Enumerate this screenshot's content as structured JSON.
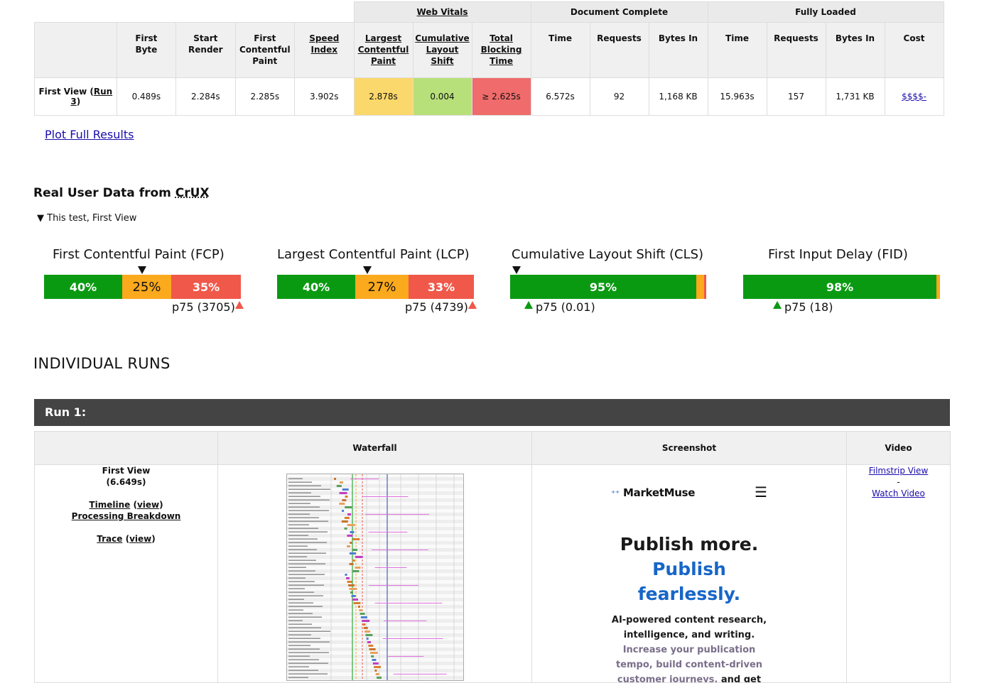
{
  "summary": {
    "groups": {
      "web_vitals": "Web Vitals",
      "document_complete": "Document Complete",
      "fully_loaded": "Fully Loaded"
    },
    "headers": {
      "first_byte": "First\nByte",
      "start_render": "Start\nRender",
      "first_contentful_paint": "First\nContentful\nPaint",
      "speed_index": "Speed\nIndex",
      "largest_contentful_paint": "Largest\nContentful\nPaint",
      "cumulative_layout_shift": "Cumulative\nLayout\nShift",
      "total_blocking_time": "Total\nBlocking\nTime",
      "dc_time": "Time",
      "dc_requests": "Requests",
      "dc_bytes": "Bytes In",
      "fl_time": "Time",
      "fl_requests": "Requests",
      "fl_bytes": "Bytes In",
      "cost": "Cost"
    },
    "row": {
      "label_prefix": "First View (",
      "label_link": "Run 3",
      "label_suffix": ")",
      "first_byte": "0.489s",
      "start_render": "2.284s",
      "fcp": "2.285s",
      "speed_index": "3.902s",
      "lcp": "2.878s",
      "cls": "0.004",
      "tbt": "≥ 2.625s",
      "dc_time": "6.572s",
      "dc_requests": "92",
      "dc_bytes": "1,168 KB",
      "fl_time": "15.963s",
      "fl_requests": "157",
      "fl_bytes": "1,731 KB",
      "cost": "$$$$-"
    },
    "colors": {
      "lcp": "#fbd86b",
      "cls": "#b8e07a",
      "tbt": "#f06b6b"
    }
  },
  "plot_link": "Plot Full Results",
  "crux": {
    "title_prefix": "Real User Data from ",
    "title_abbr": "CrUX",
    "toggle": "▼ This test, First View",
    "metrics": [
      {
        "title": "First Contentful Paint (FCP)",
        "good": 40,
        "needs": 25,
        "poor": 35,
        "good_label": "40%",
        "needs_label": "25%",
        "poor_label": "35%",
        "p75": "p75 (3705)",
        "marker_pct": 50
      },
      {
        "title": "Largest Contentful Paint (LCP)",
        "good": 40,
        "needs": 27,
        "poor": 33,
        "good_label": "40%",
        "needs_label": "27%",
        "poor_label": "33%",
        "p75": "p75 (4739)",
        "marker_pct": 46
      },
      {
        "title": "Cumulative Layout Shift (CLS)",
        "good": 95,
        "needs": 4,
        "poor": 1,
        "good_label": "95%",
        "p75": "p75 (0.01)",
        "marker_pct": 3
      },
      {
        "title": "First Input Delay (FID)",
        "good": 98,
        "needs": 2,
        "poor": 0,
        "good_label": "98%",
        "p75": "p75 (18)"
      }
    ]
  },
  "runs": {
    "title": "INDIVIDUAL RUNS",
    "run1": {
      "label": "Run 1:",
      "headers": {
        "waterfall": "Waterfall",
        "screenshot": "Screenshot",
        "video": "Video"
      },
      "first_view": "First View",
      "first_view_time": "(6.649s)",
      "timeline": "Timeline",
      "view": "view",
      "processing": "Processing Breakdown",
      "trace": "Trace",
      "filmstrip": "Filmstrip View",
      "sep": "-",
      "watch": "Watch Video",
      "screenshot": {
        "brand": "MarketMuse",
        "heading1": "Publish more.",
        "heading2": "Publish",
        "heading3": "fearlessly.",
        "para_dark1": "AI-powered content research, intelligence, and writing.",
        "para_muted": "Increase your publication tempo, build content-driven customer journeys,",
        "para_dark2": "and get discovered by the people"
      }
    }
  }
}
